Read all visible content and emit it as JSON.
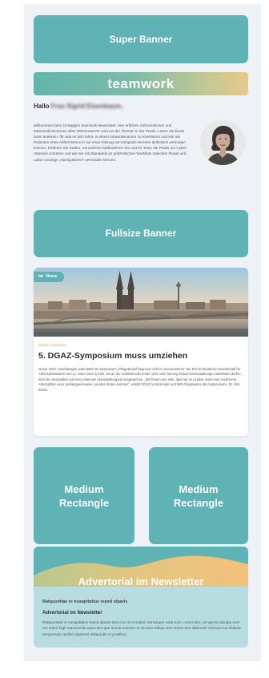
{
  "super_banner": {
    "label": "Super Banner"
  },
  "header": {
    "brand": "teamwork"
  },
  "greeting": {
    "salutation": "Hallo",
    "name": "Frau Sigrid Eisenbaum,"
  },
  "intro": {
    "text": "willkommen beim 16-tägigen teamwork-Newsletter. Hier erfahren Zahnmediziner und Zahnmedizinerinnen alles Wissenswerte rund um die Themen in der Praxis. Lesen Sie heute unter anderem, für was es sich lohnt, in einem Intraoralscanner zu investieren und wie Sie Patienten ohne Abformstress in nur einer Sitzung mit Komposit-Venoren ästhetisch versorgen können. Erfahren Sie zudem, mit welchen Maßnahmen Sie und Ihr Team die Praxis vor Cyber-Attacken schützen und wie Sie mit Standards im prothetischen Workflow zwischen Praxis und Labor unnötige „Nachjustieren“ vermeiden können."
  },
  "fullsize_banner": {
    "label": "Fullsize Banner"
  },
  "news": {
    "tag_prefix": "tw",
    "tag_label": "News",
    "author": "Mirella Cammello",
    "title": "5. DGAZ-Symposium muss umziehen",
    "body": "Immer mehr Anmeldungen unterstützt bei Symposium „Pflegebedarf begrenzt nicht im Seniorenheim“ der DGAZ (Deutsche Gesellschaft für AlterszahnMedizin) am 11. März 2023 in Köln. Da an der Uniklinik Köln leider nicht mehr Sitzung Präsenzveranstaltungen stattfinden dürfen, sind die Veranstalter auf einen externen Veranstaltungsort ausgewichen. „Wir freuen uns sehr, dass wir im Lindner Hotel eine modernere Atmosphäre einer großangemessene Location finden konnten“, erklärt DGAZ-Vorsitzender und MIR-Organisator des Symposiums, Dr. Dirk Ziebel."
  },
  "medium_rectangle_1": {
    "line1": "Medium",
    "line2": "Rectangle"
  },
  "medium_rectangle_2": {
    "line1": "Medium",
    "line2": "Rectangle"
  },
  "advertorial": {
    "title": "Advertorial im Newsletter",
    "line1": "Ratquuntiae re nusapitatius reped ulparis",
    "line2": "Advertorial im Newsletter",
    "body": "Ratquuntiae re nusapitatius reped ulparis dem nos sit occabor estrumque volut eum, conet atur, ius aperia sinulpa nam res intem fugit maximusda quia nam que omnia eossum in nConro miliqui sent venim est ullaborum rest laut ius dolupta temporeum renihit iusperest deliquodis re postibus."
  },
  "colors": {
    "teal": "#5fb3b4",
    "light_teal": "#b8dde0",
    "gold": "#f2c47a",
    "page_bg": "#eef1f5"
  }
}
